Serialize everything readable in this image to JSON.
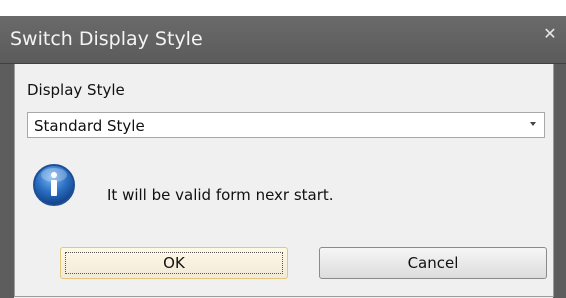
{
  "dialog": {
    "title": "Switch Display Style",
    "close_icon": "close-icon",
    "field_label": "Display Style",
    "combo": {
      "selected_value": "Standard Style"
    },
    "info_icon": "info-icon",
    "message": "It will be valid form nexr start.",
    "buttons": {
      "ok_label": "OK",
      "cancel_label": "Cancel"
    }
  },
  "colors": {
    "titlebar": "#5f5f5f",
    "dialog_bg": "#f0f0f0",
    "ok_highlight": "#e3c77b"
  }
}
